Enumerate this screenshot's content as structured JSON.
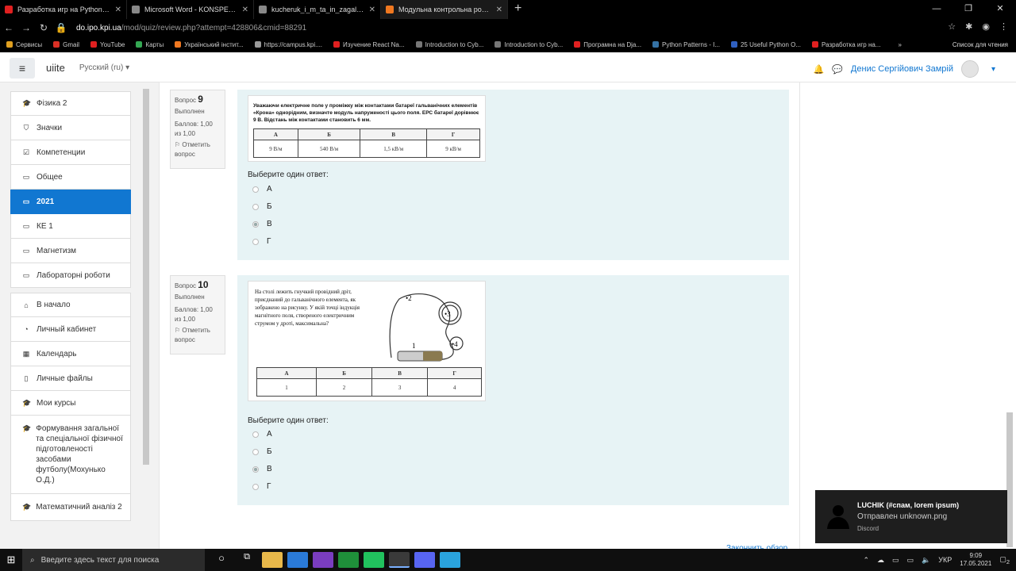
{
  "browser": {
    "tabs": [
      {
        "label": "Разработка игр на Python 3 с Py",
        "color": "#e02020"
      },
      {
        "label": "Microsoft Word - KONSPEKT_new",
        "color": "#888888"
      },
      {
        "label": "kucheruk_i_m_ta_in_zagalnii_kurs",
        "color": "#888888"
      },
      {
        "label": "Модульна контрольна робота: пе",
        "color": "#f07820",
        "active": true
      }
    ],
    "new_tab": "+",
    "url_main": "do.ipo.kpi.ua",
    "url_rest": "/mod/quiz/review.php?attempt=428806&cmid=88291",
    "bookmarks": [
      {
        "label": "Сервисы",
        "color": "#e0a020"
      },
      {
        "label": "Gmail",
        "color": "#d93025"
      },
      {
        "label": "YouTube",
        "color": "#e02020"
      },
      {
        "label": "Карты",
        "color": "#34a853"
      },
      {
        "label": "Український інстит...",
        "color": "#f07820"
      },
      {
        "label": "https://campus.kpi....",
        "color": "#999999"
      },
      {
        "label": "Изучение React Na...",
        "color": "#e02020"
      },
      {
        "label": "Introduction to Cyb...",
        "color": "#777777"
      },
      {
        "label": "Introduction to Cyb...",
        "color": "#777777"
      },
      {
        "label": "Програмна на Dja...",
        "color": "#e02020"
      },
      {
        "label": "Python Patterns - I...",
        "color": "#3572a5"
      },
      {
        "label": "25 Useful Python O...",
        "color": "#3060c0"
      },
      {
        "label": "Разработка игр на...",
        "color": "#e02020"
      }
    ],
    "bookmarks_more": "»",
    "reading_list": "Список для чтения"
  },
  "header": {
    "menu_icon": "≡",
    "site_name": "uiite",
    "language": "Русский (ru)",
    "user_name": "Денис Сергійович Замрій"
  },
  "sidebar": {
    "group1": [
      {
        "label": "Фізика 2",
        "icon": "graduation-cap-icon",
        "glyph": "🎓"
      },
      {
        "label": "Значки",
        "icon": "shield-icon",
        "glyph": "⛉"
      },
      {
        "label": "Компетенции",
        "icon": "checkbox-icon",
        "glyph": "☑"
      },
      {
        "label": "Общее",
        "icon": "folder-icon",
        "glyph": "▭"
      },
      {
        "label": "2021",
        "icon": "folder-icon",
        "glyph": "▭",
        "active": true
      },
      {
        "label": "КЕ 1",
        "icon": "folder-icon",
        "glyph": "▭"
      },
      {
        "label": "Магнетизм",
        "icon": "folder-icon",
        "glyph": "▭"
      },
      {
        "label": "Лабораторні роботи",
        "icon": "folder-icon",
        "glyph": "▭"
      }
    ],
    "group2": [
      {
        "label": "В начало",
        "icon": "home-icon",
        "glyph": "⌂"
      },
      {
        "label": "Личный кабинет",
        "icon": "dashboard-icon",
        "glyph": "◔"
      },
      {
        "label": "Календарь",
        "icon": "calendar-icon",
        "glyph": "▦"
      },
      {
        "label": "Личные файлы",
        "icon": "file-icon",
        "glyph": "▯"
      },
      {
        "label": "Мои курсы",
        "icon": "graduation-cap-icon",
        "glyph": "🎓"
      }
    ],
    "courses": [
      "Формування загальної та спеціальної фізичної підготовленості засобами футболу(Мохунько О.Д.)",
      "Математичний аналіз 2"
    ]
  },
  "quiz": {
    "q_word": "Вопрос",
    "status": "Выполнен",
    "score": "Баллов: 1,00 из 1,00",
    "flag": "Отметить вопрос",
    "prompt": "Выберите один ответ:",
    "questions": [
      {
        "number": "9",
        "text": "Уважаючи електричне поле у проміжку між контактами батареї гальванічних елементів «Крона» однорідним, визначте модуль напруженості цього поля. ЕРС батареї дорівнює 9 В. Відстань між контактами становить 6 мм.",
        "table_head": [
          "А",
          "Б",
          "В",
          "Г"
        ],
        "table_vals": [
          "9 В/м",
          "540 В/м",
          "1,5 кВ/м",
          "9 кВ/м"
        ],
        "options": [
          "А",
          "Б",
          "В",
          "Г"
        ],
        "selected": 2
      },
      {
        "number": "10",
        "text": "На столі лежить гнучкий провідний дріт, приєднаний до гальванічного елемента, як зображено на рисунку. У якій точці індукція магнітного поля, створеного електричним струмом у дроті, максимальна?",
        "figure_labels": [
          "•2",
          "•3",
          "1",
          "•4"
        ],
        "table_head": [
          "А",
          "Б",
          "В",
          "Г"
        ],
        "table_vals": [
          "1",
          "2",
          "3",
          "4"
        ],
        "options": [
          "А",
          "Б",
          "В",
          "Г"
        ],
        "selected": 2
      }
    ],
    "finish_link": "Закончить обзор"
  },
  "notification": {
    "title": "LUCHIK (#спам, lorem ipsum)",
    "message": "Отправлен unknown.png",
    "app": "Discord"
  },
  "taskbar": {
    "search_placeholder": "Введите здесь текст для поиска",
    "language": "УКР",
    "time": "9:09",
    "date": "17.05.2021",
    "notif_count": "2"
  }
}
